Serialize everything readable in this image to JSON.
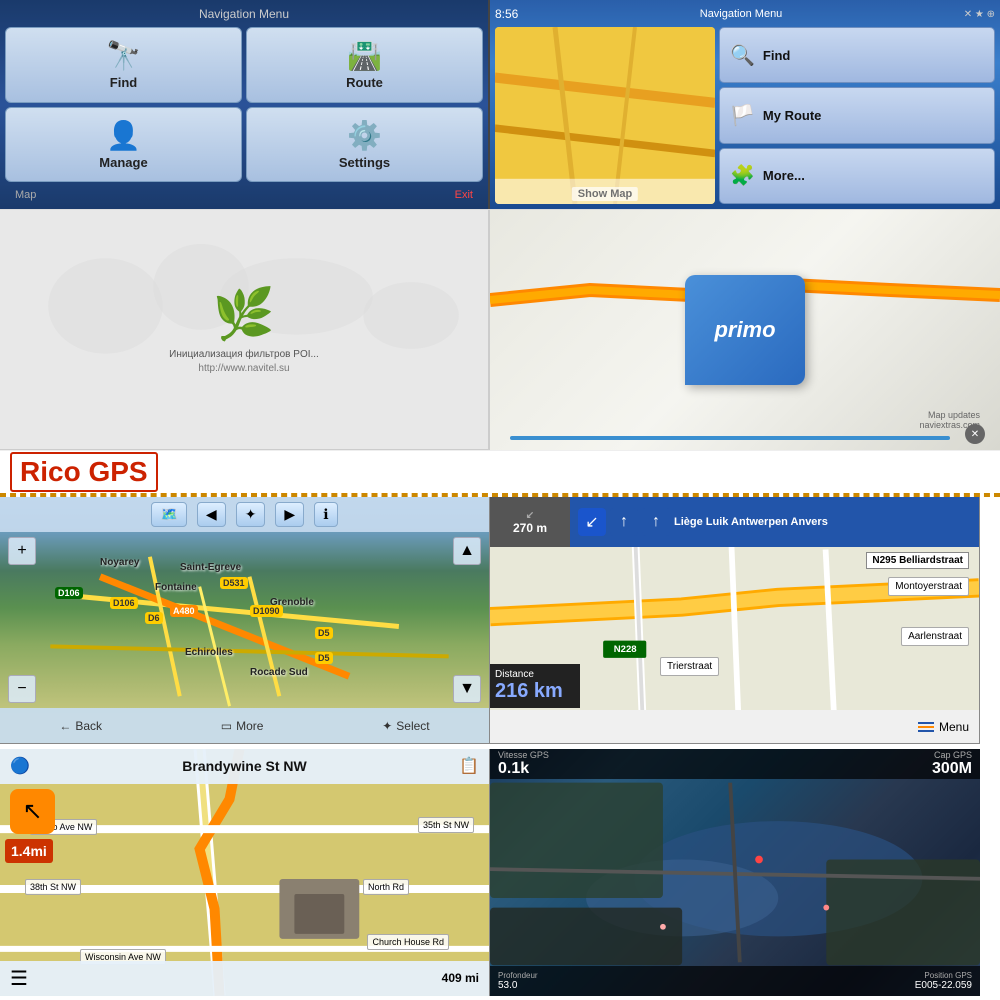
{
  "top_left_menu": {
    "title": "Navigation Menu",
    "items": [
      {
        "label": "Find",
        "icon": "🔭"
      },
      {
        "label": "Route",
        "icon": "🛣️"
      },
      {
        "label": "Manage",
        "icon": "👤"
      },
      {
        "label": "Settings",
        "icon": "⚙️"
      }
    ],
    "bottom_left": "Map",
    "bottom_right": "Exit"
  },
  "top_right_menu": {
    "title": "Navigation Menu",
    "time": "8:56",
    "show_map_label": "Show Map",
    "buttons": [
      {
        "label": "Find",
        "icon": "🔍"
      },
      {
        "label": "My Route",
        "icon": "🏳️"
      },
      {
        "label": "More...",
        "icon": "🧩"
      }
    ]
  },
  "navitel": {
    "loading_text": "Инициализация фильтров POI...",
    "url": "http://www.navitel.su"
  },
  "primo": {
    "logo_text": "primo",
    "map_updates": "Map updates",
    "website": "naviextras.com"
  },
  "rico_gps": {
    "label": "Rico GPS"
  },
  "panel1": {
    "city_labels": [
      "Noyarey",
      "Saint-Egreve",
      "Fontaine",
      "Grenoble",
      "Echirolles",
      "Rocade Sud"
    ],
    "road_labels": [
      "D106",
      "D106",
      "D6",
      "D531",
      "D1090",
      "A480",
      "D5",
      "D5"
    ],
    "bottom_items": [
      "Back",
      "More",
      "Select"
    ]
  },
  "panel2": {
    "distance": "270 m",
    "road_top": "Liège Luik Antwerpen Anvers",
    "road_right": "N295 Belliardstraat",
    "road_n228": "N228",
    "streets": [
      "Trierstraat",
      "Montoyerstraat",
      "Aarlenstraat"
    ],
    "dist_label": "Distance",
    "dist_value": "216 km",
    "menu_label": "Menu"
  },
  "panel3": {
    "street_name": "Brandywine St NW",
    "distance": "1.4mi",
    "street_labels": [
      "Idaho Ave NW",
      "35th St NW",
      "38th St NW",
      "North Rd",
      "Church House Rd",
      "Wisconsin Ave NW"
    ],
    "bottom_distance": "409 mi"
  },
  "panel4": {
    "vitesse_label": "Vitesse GPS",
    "vitesse_value": "0.1k",
    "cap_label": "Cap GPS",
    "cap_value": "300M",
    "profondeur_label": "Profondeur",
    "profondeur_value": "53.0",
    "position_label": "Position GPS",
    "position_value": "E005-22.059"
  }
}
